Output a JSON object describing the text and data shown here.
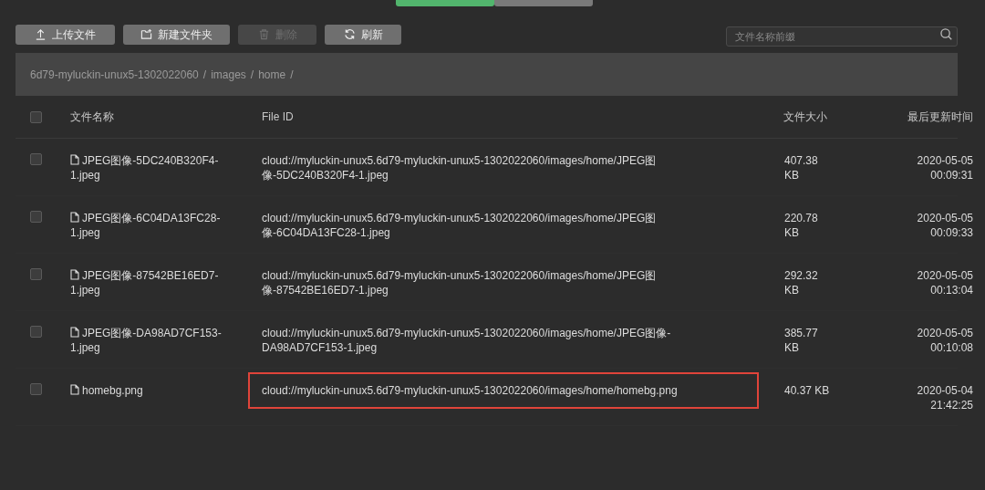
{
  "tabs": [
    {
      "selected": true
    },
    {
      "selected": false
    }
  ],
  "toolbar": {
    "buttons": [
      {
        "label": "上传文件",
        "kind": "upload",
        "disabled": false
      },
      {
        "label": "新建文件夹",
        "kind": "folder",
        "disabled": false
      },
      {
        "label": "删除",
        "kind": "delete",
        "disabled": true
      },
      {
        "label": "刷新",
        "kind": "refresh",
        "disabled": false
      }
    ],
    "search": {
      "placeholder": "文件名称前缀"
    }
  },
  "breadcrumb": [
    {
      "label": "6d79-myluckin-unux5-1302022060",
      "separator": "/"
    },
    {
      "label": "images",
      "separator": "/"
    },
    {
      "label": "home",
      "separator": "/"
    }
  ],
  "table": {
    "all_checked": false,
    "columns": [
      "文件名称",
      "File ID",
      "文件大小",
      "最后更新时间"
    ],
    "rows": [
      {
        "checked": false,
        "name": "JPEG图像-5DC240B320F4-1.jpeg",
        "file_id": "cloud://myluckin-unux5.6d79-myluckin-unux5-1302022060/images/home/JPEG图像-5DC240B320F4-1.jpeg",
        "size": "407.38 KB",
        "time": "2020-05-05 00:09:31",
        "highlighted": false
      },
      {
        "checked": false,
        "name": "JPEG图像-6C04DA13FC28-1.jpeg",
        "file_id": "cloud://myluckin-unux5.6d79-myluckin-unux5-1302022060/images/home/JPEG图像-6C04DA13FC28-1.jpeg",
        "size": "220.78 KB",
        "time": "2020-05-05 00:09:33",
        "highlighted": false
      },
      {
        "checked": false,
        "name": "JPEG图像-87542BE16ED7-1.jpeg",
        "file_id": "cloud://myluckin-unux5.6d79-myluckin-unux5-1302022060/images/home/JPEG图像-87542BE16ED7-1.jpeg",
        "size": "292.32 KB",
        "time": "2020-05-05 00:13:04",
        "highlighted": false
      },
      {
        "checked": false,
        "name": "JPEG图像-DA98AD7CF153-1.jpeg",
        "file_id": "cloud://myluckin-unux5.6d79-myluckin-unux5-1302022060/images/home/JPEG图像-DA98AD7CF153-1.jpeg",
        "size": "385.77 KB",
        "time": "2020-05-05 00:10:08",
        "highlighted": false
      },
      {
        "checked": false,
        "name": "homebg.png",
        "file_id": "cloud://myluckin-unux5.6d79-myluckin-unux5-1302022060/images/home/homebg.png",
        "size": "40.37 KB",
        "time": "2020-05-04 21:42:25",
        "highlighted": true
      }
    ]
  }
}
